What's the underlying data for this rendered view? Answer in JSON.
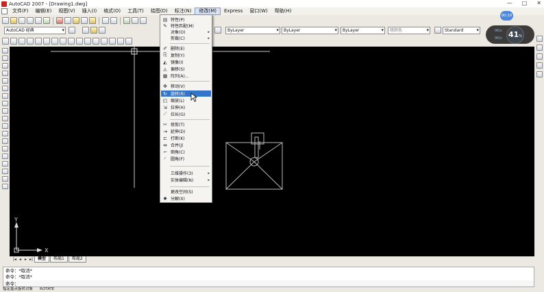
{
  "titlebar": {
    "title": "AutoCAD 2007 - [Drawing1.dwg]",
    "controls": [
      "—",
      "□",
      "✕"
    ]
  },
  "menubar": {
    "items": [
      {
        "label": "文件(F)"
      },
      {
        "label": "编辑(E)"
      },
      {
        "label": "视图(V)"
      },
      {
        "label": "插入(I)"
      },
      {
        "label": "格式(O)"
      },
      {
        "label": "工具(T)"
      },
      {
        "label": "绘图(D)"
      },
      {
        "label": "标注(N)"
      },
      {
        "label": "修改(M)"
      },
      {
        "label": "Express"
      },
      {
        "label": "窗口(W)"
      },
      {
        "label": "帮助(H)"
      }
    ],
    "active_index": 8
  },
  "toolbar": {
    "workspace": "AutoCAD 经典",
    "layer_combo": "ByLayer",
    "color_combo": "ByLayer",
    "linetype_combo": "ByLayer",
    "lineweight_combo": "ByLayer",
    "plotstyle_combo": "随颜色",
    "textstyle_combo": "Standard"
  },
  "modify_menu": {
    "items": [
      {
        "label": "特性(P)",
        "icon": "properties-icon",
        "glyph": "▤"
      },
      {
        "label": "特性匹配(M)",
        "icon": "match-properties-icon",
        "glyph": "✎"
      },
      {
        "label": "对象(O)",
        "icon": "",
        "glyph": "",
        "submenu": true
      },
      {
        "label": "剪裁(C)",
        "icon": "",
        "glyph": "",
        "submenu": true
      },
      {
        "label": "删除(E)",
        "icon": "erase-icon",
        "glyph": "✐"
      },
      {
        "label": "复制(Y)",
        "icon": "copy-icon",
        "glyph": "⎘"
      },
      {
        "label": "镜像(I)",
        "icon": "mirror-icon",
        "glyph": "◭"
      },
      {
        "label": "偏移(S)",
        "icon": "offset-icon",
        "glyph": "◬"
      },
      {
        "label": "阵列(A)...",
        "icon": "array-icon",
        "glyph": "▦"
      },
      {
        "label": "移动(V)",
        "icon": "move-icon",
        "glyph": "✥"
      },
      {
        "label": "旋转(R)",
        "icon": "rotate-icon",
        "glyph": "↻"
      },
      {
        "label": "缩放(L)",
        "icon": "scale-icon",
        "glyph": "◰"
      },
      {
        "label": "拉伸(H)",
        "icon": "stretch-icon",
        "glyph": "⇲"
      },
      {
        "label": "拉长(G)",
        "icon": "lengthen-icon",
        "glyph": "⟋"
      },
      {
        "label": "修剪(T)",
        "icon": "trim-icon",
        "glyph": "✂"
      },
      {
        "label": "延伸(D)",
        "icon": "extend-icon",
        "glyph": "⇥"
      },
      {
        "label": "打断(K)",
        "icon": "break-icon",
        "glyph": "⊏"
      },
      {
        "label": "合并(J)",
        "icon": "join-icon",
        "glyph": "⇹"
      },
      {
        "label": "倒角(C)",
        "icon": "chamfer-icon",
        "glyph": "⌐"
      },
      {
        "label": "圆角(F)",
        "icon": "fillet-icon",
        "glyph": "◜"
      },
      {
        "label": "三维操作(3)",
        "icon": "",
        "glyph": "",
        "submenu": true
      },
      {
        "label": "实体编辑(N)",
        "icon": "",
        "glyph": "",
        "submenu": true
      },
      {
        "label": "更改空间(S)",
        "icon": "",
        "glyph": ""
      },
      {
        "label": "分解(X)",
        "icon": "explode-icon",
        "glyph": "✸"
      }
    ],
    "highlighted_index": 10
  },
  "canvas": {
    "ucs_x": "X",
    "ucs_y": "Y"
  },
  "tabs": {
    "nav": [
      "|◂",
      "◂",
      "▸",
      "▸|"
    ],
    "items": [
      "模型",
      "布局1",
      "布局2"
    ],
    "active_index": 0
  },
  "command": {
    "line1": "命令：*取消*",
    "line2": "命令：*取消*",
    "line3": "命令："
  },
  "status": {
    "prompt": "指定基点旋转对象",
    "command_name": "ROTATE"
  },
  "overlay": {
    "timer": "00:10",
    "zoom_value": "41",
    "zoom_unit": "%",
    "upload": "0K/s",
    "download": "0K/s"
  }
}
